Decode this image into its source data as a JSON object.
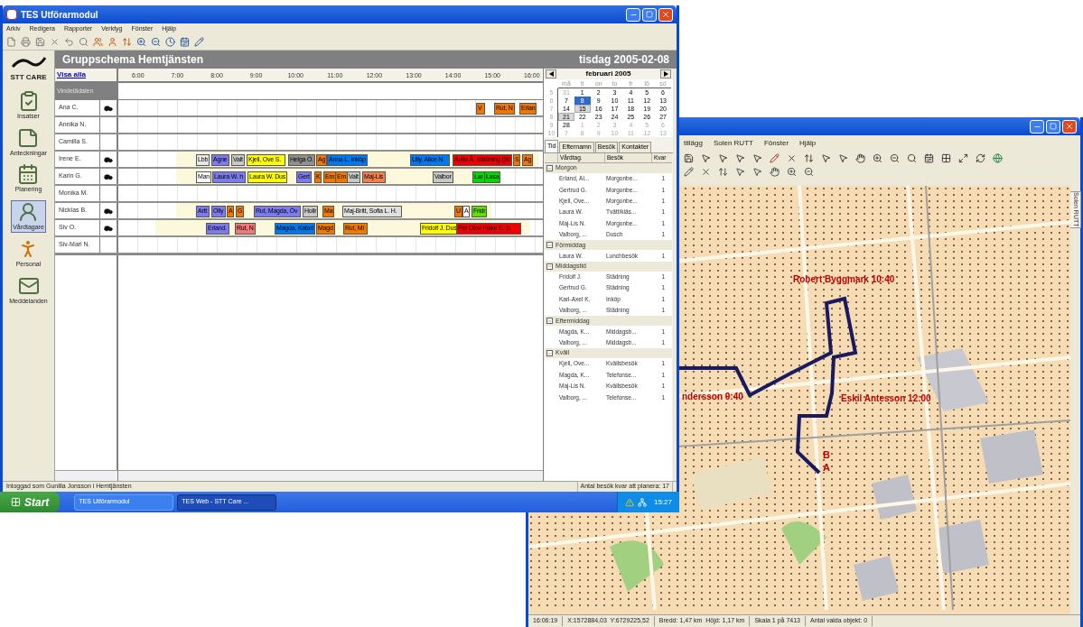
{
  "main_window": {
    "title": "TES Utförarmodul",
    "menu": [
      "Arkiv",
      "Redigera",
      "Rapporter",
      "Verktyg",
      "Fönster",
      "Hjälp"
    ],
    "header": {
      "title": "Gruppschema Hemtjänsten",
      "date": "tisdag 2005-02-08"
    },
    "sidebar": {
      "logo": "STT CARE",
      "items": [
        {
          "label": "Insatser",
          "kind": "clipboard",
          "selected": false
        },
        {
          "label": "Anteckningar",
          "kind": "note",
          "selected": false
        },
        {
          "label": "Planering",
          "kind": "planner",
          "selected": false
        },
        {
          "label": "Vårdtagare",
          "kind": "client",
          "selected": true
        },
        {
          "label": "Personal",
          "kind": "staff",
          "selected": false
        },
        {
          "label": "Meddelanden",
          "kind": "message",
          "selected": false
        }
      ]
    },
    "schedule": {
      "show_all": "Visa alla",
      "group": "Vindelädalen",
      "hours": [
        "6:00",
        "7:00",
        "8:00",
        "9:00",
        "10:00",
        "11:00",
        "12:00",
        "13:00",
        "14:00",
        "15:00",
        "16:00"
      ],
      "rows": [
        {
          "name": "Ana C.",
          "car": true,
          "on_shift": false,
          "visits": [
            {
              "label": "V",
              "color": "#f07800"
            },
            {
              "label": "Rut, N",
              "color": "#f07800"
            },
            {
              "label": "Erlan",
              "color": "#f07800"
            }
          ]
        },
        {
          "name": "Annika N.",
          "car": false,
          "on_shift": false,
          "visits": []
        },
        {
          "name": "Camilla S.",
          "car": false,
          "on_shift": false,
          "visits": []
        },
        {
          "name": "Irene E.",
          "car": true,
          "on_shift": true,
          "visits": [
            {
              "label": "Lbb",
              "color": "#e8e8e8"
            },
            {
              "label": "Agne",
              "color": "#7b7bef"
            },
            {
              "label": "Valt",
              "color": "#c8c8c8"
            },
            {
              "label": "Kjell, Ove S.",
              "color": "#ffff00"
            },
            {
              "label": "Helga Ö.",
              "color": "#909090"
            },
            {
              "label": "Ag",
              "color": "#f07800"
            },
            {
              "label": "Anna L. Inköp",
              "color": "#0078f0"
            },
            {
              "label": "Ully, Alice N.",
              "color": "#0078f0"
            },
            {
              "label": "Anita Å. Städning (50",
              "color": "#f00000"
            },
            {
              "label": "S",
              "color": "#f07800"
            },
            {
              "label": "Ag",
              "color": "#f07800"
            }
          ]
        },
        {
          "name": "Karin G.",
          "car": true,
          "on_shift": true,
          "visits": [
            {
              "label": "Man",
              "color": "#ffffff"
            },
            {
              "label": "Laura W. h",
              "color": "#7b7bef"
            },
            {
              "label": "Laura W. Dus",
              "color": "#ffff00"
            },
            {
              "label": "Gert",
              "color": "#7b7bef"
            },
            {
              "label": "K",
              "color": "#f07800"
            },
            {
              "label": "Em",
              "color": "#f07800"
            },
            {
              "label": "Em",
              "color": "#f07800"
            },
            {
              "label": "Valt",
              "color": "#c8c8c8"
            },
            {
              "label": "Maj-Lis",
              "color": "#f08050"
            },
            {
              "label": "Valbor",
              "color": "#c8c8c8"
            },
            {
              "label": "Lar",
              "color": "#00d800"
            },
            {
              "label": "Lasa",
              "color": "#00d800"
            }
          ]
        },
        {
          "name": "Monika M.",
          "car": false,
          "on_shift": false,
          "visits": []
        },
        {
          "name": "Nicklas B.",
          "car": true,
          "on_shift": true,
          "visits": [
            {
              "label": "Artt",
              "color": "#7b7bef"
            },
            {
              "label": "Olly",
              "color": "#7b7bef"
            },
            {
              "label": "A",
              "color": "#f07800"
            },
            {
              "label": "G",
              "color": "#f07800"
            },
            {
              "label": "Rut, Magda, Öv",
              "color": "#7b7bef"
            },
            {
              "label": "Hollr",
              "color": "#c8c8c8"
            },
            {
              "label": "Ma",
              "color": "#f07800"
            },
            {
              "label": "Maj-Britt, Sofia L. H.",
              "color": "#e0e0e0"
            },
            {
              "label": "U",
              "color": "#f07800"
            },
            {
              "label": "A",
              "color": "#ffffff"
            },
            {
              "label": "Fridr",
              "color": "#60e000"
            }
          ]
        },
        {
          "name": "Siv O.",
          "car": true,
          "on_shift": true,
          "visits": [
            {
              "label": "Erland.",
              "color": "#7b7bef"
            },
            {
              "label": "Rut, N",
              "color": "#f07878"
            },
            {
              "label": "Magda, Katari",
              "color": "#0078f0"
            },
            {
              "label": "Magd",
              "color": "#f07800"
            },
            {
              "label": "Rut, Mi",
              "color": "#f07800"
            },
            {
              "label": "Fridolf J. Dus",
              "color": "#ffff00"
            },
            {
              "label": "Per Olov Folke E. S",
              "color": "#f00000"
            }
          ]
        },
        {
          "name": "Siv-Mari N.",
          "car": false,
          "on_shift": false,
          "visits": []
        }
      ]
    },
    "calendar": {
      "month": "februari 2005",
      "weekdays": [
        "må",
        "ti",
        "on",
        "to",
        "fr",
        "lö",
        "sö"
      ],
      "weeks": [
        {
          "week": "5",
          "days": [
            {
              "d": "31",
              "other_month": true,
              "selected": false,
              "marked": false
            },
            {
              "d": "1",
              "other_month": false,
              "selected": false,
              "marked": false
            },
            {
              "d": "2",
              "other_month": false,
              "selected": false,
              "marked": false
            },
            {
              "d": "3",
              "other_month": false,
              "selected": false,
              "marked": false
            },
            {
              "d": "4",
              "other_month": false,
              "selected": false,
              "marked": false
            },
            {
              "d": "5",
              "other_month": false,
              "selected": false,
              "marked": false
            },
            {
              "d": "6",
              "other_month": false,
              "selected": false,
              "marked": false
            }
          ]
        },
        {
          "week": "6",
          "days": [
            {
              "d": "7",
              "other_month": false,
              "selected": false,
              "marked": false
            },
            {
              "d": "8",
              "other_month": false,
              "selected": true,
              "marked": false
            },
            {
              "d": "9",
              "other_month": false,
              "selected": false,
              "marked": false
            },
            {
              "d": "10",
              "other_month": false,
              "selected": false,
              "marked": false
            },
            {
              "d": "11",
              "other_month": false,
              "selected": false,
              "marked": false
            },
            {
              "d": "12",
              "other_month": false,
              "selected": false,
              "marked": false
            },
            {
              "d": "13",
              "other_month": false,
              "selected": false,
              "marked": false
            }
          ]
        },
        {
          "week": "7",
          "days": [
            {
              "d": "14",
              "other_month": false,
              "selected": false,
              "marked": false
            },
            {
              "d": "15",
              "other_month": false,
              "selected": false,
              "marked": true
            },
            {
              "d": "16",
              "other_month": false,
              "selected": false,
              "marked": false
            },
            {
              "d": "17",
              "other_month": false,
              "selected": false,
              "marked": false
            },
            {
              "d": "18",
              "other_month": false,
              "selected": false,
              "marked": false
            },
            {
              "d": "19",
              "other_month": false,
              "selected": false,
              "marked": false
            },
            {
              "d": "20",
              "other_month": false,
              "selected": false,
              "marked": false
            }
          ]
        },
        {
          "week": "8",
          "days": [
            {
              "d": "21",
              "other_month": false,
              "selected": false,
              "marked": true
            },
            {
              "d": "22",
              "other_month": false,
              "selected": false,
              "marked": false
            },
            {
              "d": "23",
              "other_month": false,
              "selected": false,
              "marked": false
            },
            {
              "d": "24",
              "other_month": false,
              "selected": false,
              "marked": false
            },
            {
              "d": "25",
              "other_month": false,
              "selected": false,
              "marked": false
            },
            {
              "d": "26",
              "other_month": false,
              "selected": false,
              "marked": false
            },
            {
              "d": "27",
              "other_month": false,
              "selected": false,
              "marked": false
            }
          ]
        },
        {
          "week": "9",
          "days": [
            {
              "d": "28",
              "other_month": false,
              "selected": false,
              "marked": false
            },
            {
              "d": "1",
              "other_month": true,
              "selected": false,
              "marked": false
            },
            {
              "d": "2",
              "other_month": true,
              "selected": false,
              "marked": false
            },
            {
              "d": "3",
              "other_month": true,
              "selected": false,
              "marked": false
            },
            {
              "d": "4",
              "other_month": true,
              "selected": false,
              "marked": false
            },
            {
              "d": "5",
              "other_month": true,
              "selected": false,
              "marked": false
            },
            {
              "d": "6",
              "other_month": true,
              "selected": false,
              "marked": false
            }
          ]
        },
        {
          "week": "10",
          "days": [
            {
              "d": "7",
              "other_month": true,
              "selected": false,
              "marked": false
            },
            {
              "d": "8",
              "other_month": true,
              "selected": false,
              "marked": false
            },
            {
              "d": "9",
              "other_month": true,
              "selected": false,
              "marked": false
            },
            {
              "d": "10",
              "other_month": true,
              "selected": false,
              "marked": false
            },
            {
              "d": "11",
              "other_month": true,
              "selected": false,
              "marked": false
            },
            {
              "d": "12",
              "other_month": true,
              "selected": false,
              "marked": false
            },
            {
              "d": "13",
              "other_month": true,
              "selected": false,
              "marked": false
            }
          ]
        }
      ]
    },
    "tabs": [
      {
        "label": "Tid",
        "selected": true
      },
      {
        "label": "Efternamn",
        "selected": false
      },
      {
        "label": "Besök",
        "selected": false
      },
      {
        "label": "Kontakter",
        "selected": false
      }
    ],
    "list": {
      "columns": [
        "Vårdtag.",
        "Besök",
        "Kvar"
      ],
      "groups": [
        {
          "label": "Morgon",
          "expanded": true,
          "rows": [
            [
              "Erland, Al...",
              "Morgonbe...",
              "1"
            ],
            [
              "Gertrud G.",
              "Morgonbe...",
              "1"
            ],
            [
              "Kjell, Ove...",
              "Morgonbe...",
              "1"
            ],
            [
              "Laura W.",
              "Tvätt/kläs...",
              "1"
            ],
            [
              "Maj-Lis N.",
              "Morgonbe...",
              "1"
            ],
            [
              "Valborg, ...",
              "Dusch",
              "1"
            ]
          ]
        },
        {
          "label": "Förmiddag",
          "expanded": true,
          "rows": [
            [
              "Laura W.",
              "Lunchbesök",
              "1"
            ]
          ]
        },
        {
          "label": "Middagstid",
          "expanded": true,
          "rows": [
            [
              "Fridolf J.",
              "Städning",
              "1"
            ],
            [
              "Gertrud G.",
              "Städning",
              "1"
            ],
            [
              "Karl-Axel K.",
              "Inköp",
              "1"
            ],
            [
              "Valborg, ...",
              "Städning",
              "1"
            ]
          ]
        },
        {
          "label": "Eftermiddag",
          "expanded": true,
          "rows": [
            [
              "Magda, K...",
              "Middagsb...",
              "1"
            ],
            [
              "Valborg, ...",
              "Middagsb...",
              "1"
            ]
          ]
        },
        {
          "label": "Kväll",
          "expanded": true,
          "rows": [
            [
              "Kjell, Ove...",
              "Kvällsbesök",
              "1"
            ],
            [
              "Magda, K...",
              "Telefonse...",
              "1"
            ],
            [
              "Maj-Lis N.",
              "Kvällsbesök",
              "1"
            ],
            [
              "Valborg, ...",
              "Telefonse...",
              "1"
            ]
          ]
        }
      ]
    },
    "status_left": "Inloggad som Gunilla Jonsson i Hemtjänsten",
    "status_right": "Antal besök kvar att planera: 17"
  },
  "taskbar": {
    "start": "Start",
    "tasks": [
      {
        "label": "TES Utförarmodul",
        "selected": false
      },
      {
        "label": "TES Web - STT Care ...",
        "selected": true
      }
    ],
    "clock": "15:27"
  },
  "map_window": {
    "menu": [
      "tillägg",
      "Solen RUTT",
      "Fönster",
      "Hjälp"
    ],
    "side_tab": "Solen RUTT",
    "labels": [
      {
        "text": "Robert Byggmark 10:40",
        "kind": "stop"
      },
      {
        "text": "ndersson 9:40",
        "kind": "stop"
      },
      {
        "text": "Eskil Antesson 12:00",
        "kind": "stop"
      },
      {
        "text": "B",
        "kind": "point"
      },
      {
        "text": "A",
        "kind": "point"
      }
    ],
    "status": [
      "16:06:19",
      "X:1572884,03  Y:6729225,52",
      "Bredd: 1,47 km  Höjd: 1,17 km",
      "Skala 1 på 7413",
      "Antal valda objekt: 0"
    ]
  }
}
